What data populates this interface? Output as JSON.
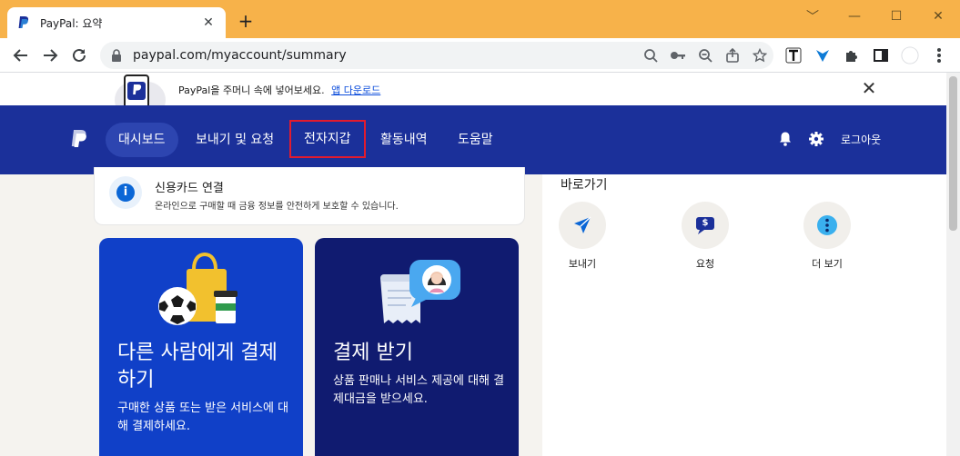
{
  "browser": {
    "tab_title": "PayPal: 요약",
    "new_tab_symbol": "+",
    "url": "paypal.com/myaccount/summary",
    "win_minimize": "﹀",
    "win_restore": "—",
    "win_max": "☐",
    "win_close": "✕"
  },
  "banner": {
    "text": "PayPal을 주머니 속에 넣어보세요.",
    "link": "앱 다운로드"
  },
  "nav": {
    "items": [
      "대시보드",
      "보내기 및 요청",
      "전자지갑",
      "활동내역",
      "도움말"
    ],
    "logout": "로그아웃"
  },
  "info_card": {
    "title": "신용카드 연결",
    "subtitle": "온라인으로 구매할 때 금융 정보를 안전하게 보호할 수 있습니다.",
    "badge": "i"
  },
  "cards": [
    {
      "title": "다른 사람에게 결제하기",
      "desc": "구매한 상품 또는 받은 서비스에 대해 결제하세요."
    },
    {
      "title": "결제 받기",
      "desc": "상품 판매나 서비스 제공에 대해 결제대금을 받으세요."
    }
  ],
  "quick": {
    "title": "바로가기",
    "items": [
      {
        "label": "보내기",
        "icon": "send-icon"
      },
      {
        "label": "요청",
        "icon": "request-icon"
      },
      {
        "label": "더 보기",
        "icon": "more-icon"
      }
    ],
    "request_symbol": "$"
  },
  "colors": {
    "brand_navy": "#1b309a",
    "card_blue": "#1040c8",
    "card_navy": "#101b70",
    "chrome_orange": "#f7b24a",
    "highlight_red": "#e21b2e"
  }
}
